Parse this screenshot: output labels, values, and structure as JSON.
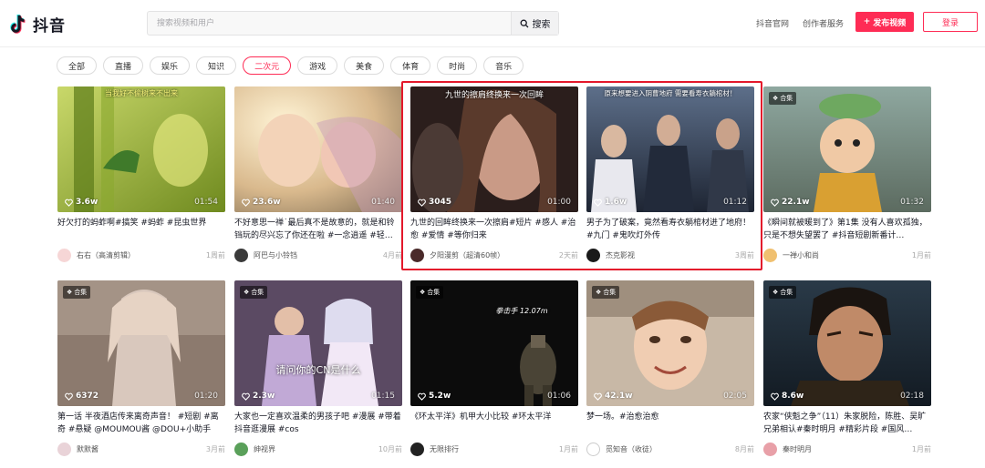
{
  "header": {
    "logo_text": "抖音",
    "search_placeholder": "搜索视频和用户",
    "search_label": "搜索",
    "nav": [
      "抖音官网",
      "创作者服务"
    ],
    "upload_label": "发布视频",
    "login_label": "登录"
  },
  "categories": [
    "全部",
    "直播",
    "娱乐",
    "知识",
    "二次元",
    "游戏",
    "美食",
    "体育",
    "时尚",
    "音乐"
  ],
  "active_category": "二次元",
  "videos": [
    {
      "likes": "3.6w",
      "duration": "01:54",
      "overlay": "当我好不偷树来不出来",
      "collection": "",
      "title": "好欠打的蚂蚱啊#搞笑 #蚂蚱 #昆虫世界",
      "author": "右右（高清剪辑）",
      "time": "1周前"
    },
    {
      "likes": "23.6w",
      "duration": "01:40",
      "overlay": "",
      "collection": "",
      "title": "不好意思一禅˙最后真不是故意的，就是和铃铛玩的尽兴忘了你还在啦 #一念逍遥 #轻…",
      "author": "阿巴与小铃铛",
      "time": "4月前"
    },
    {
      "likes": "3045",
      "duration": "01:00",
      "overlay": "九世的擦肩终换来一次回眸",
      "collection": "",
      "title": "九世的回眸终换来一次擦肩#短片 #感人 #治愈 #爱情 #等你归来",
      "author": "夕阳漫剪（超清60帧）",
      "time": "2天前"
    },
    {
      "likes": "1.6w",
      "duration": "01:12",
      "overlay": "原来想要进入阴曹地府  需要看寿衣躺棺材！",
      "collection": "",
      "title": "男子为了破案，竟然看寿衣躺棺材进了地府！ #九门 #鬼吹灯外传",
      "author": "杰克影视",
      "time": "3周前"
    },
    {
      "likes": "22.1w",
      "duration": "01:32",
      "overlay": "",
      "collection": "合集",
      "title": "《瞬间就被暖到了》第1集 没有人喜欢孤独，只是不想失望罢了 #抖音短剧新番计…",
      "author": "一禅小和尚",
      "time": "1月前"
    },
    {
      "likes": "6372",
      "duration": "01:20",
      "overlay": "",
      "collection": "合集",
      "title": "第一话 半夜酒店传来离奇声音！ #短剧 #离奇 #悬疑 @MOUMOU酱 @DOU+小助手",
      "author": "默默酱",
      "time": "3月前"
    },
    {
      "likes": "2.3w",
      "duration": "01:15",
      "overlay": "请问你的CN是什么",
      "collection": "合集",
      "title": "大家也一定喜欢温柔的男孩子吧 #漫展 #带着抖音逛漫展 #cos",
      "author": "绅视界",
      "time": "10月前"
    },
    {
      "likes": "5.2w",
      "duration": "01:06",
      "overlay": "拳击手 12.07m",
      "collection": "合集",
      "title": "《环太平洋》机甲大小比较 #环太平洋",
      "author": "无限排行",
      "time": "1月前"
    },
    {
      "likes": "42.1w",
      "duration": "02:05",
      "overlay": "",
      "collection": "合集",
      "title": "梦一场。#治愈治愈",
      "author": "觅知音（收徒）",
      "time": "8月前"
    },
    {
      "likes": "8.6w",
      "duration": "02:18",
      "overlay": "",
      "collection": "合集",
      "title": "农家“侠魁之争”（11）朱家脱险，陈胜、吴旷兄弟相认#秦时明月 #精彩片段 #国风…",
      "author": "秦时明月",
      "time": "1月前"
    }
  ],
  "colors": {
    "accent": "#fe2c55",
    "highlight_box": "#e3182b"
  }
}
